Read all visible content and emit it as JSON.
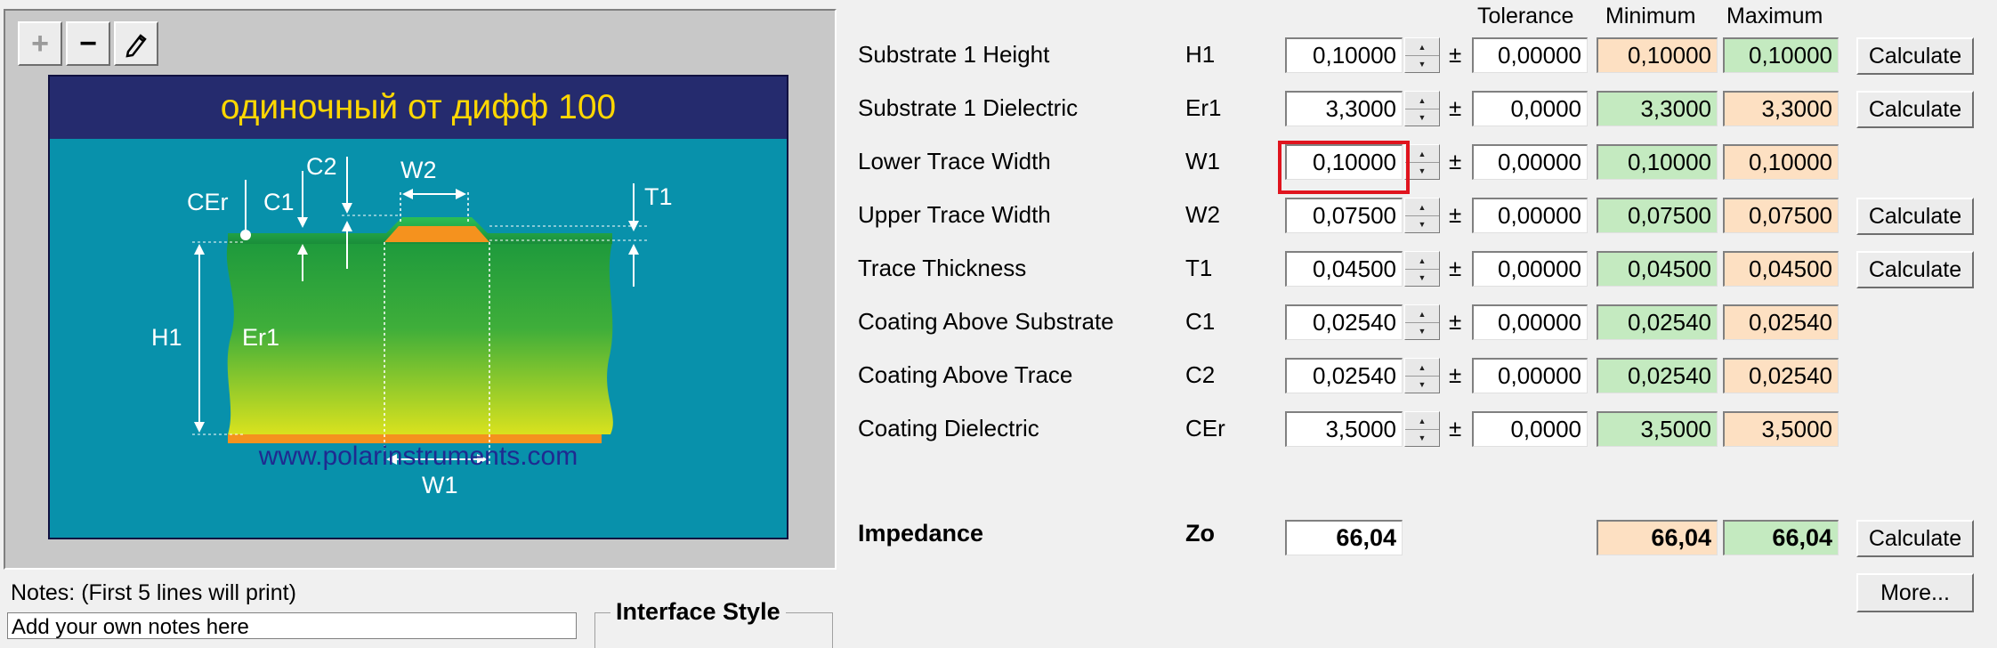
{
  "toolbar": {
    "zoom_in_icon": "plus-icon",
    "zoom_out_icon": "minus-icon",
    "edit_icon": "pencil-icon"
  },
  "diagram": {
    "title": "одиночный от дифф 100",
    "labels": {
      "cer": "CEr",
      "c1": "C1",
      "c2": "C2",
      "w2": "W2",
      "t1": "T1",
      "h1": "H1",
      "er1": "Er1",
      "w1": "W1"
    },
    "website": "www.polarinstruments.com",
    "colors": {
      "title_band": "#252b6e",
      "title_text": "#ffd700",
      "background": "#0891ab",
      "trace": "#f5921e"
    }
  },
  "notes": {
    "label": "Notes: (First 5 lines will print)",
    "value": "Add your own notes here"
  },
  "interface_style": {
    "label": "Interface Style"
  },
  "table": {
    "headers": {
      "tolerance": "Tolerance",
      "minimum": "Minimum",
      "maximum": "Maximum"
    },
    "rows": [
      {
        "label": "Substrate 1 Height",
        "symbol": "H1",
        "value": "0,10000",
        "tolerance": "0,00000",
        "minimum": "0,10000",
        "maximum": "0,10000",
        "min_color": "orange",
        "max_color": "green",
        "calculate": "Calculate"
      },
      {
        "label": "Substrate 1 Dielectric",
        "symbol": "Er1",
        "value": "3,3000",
        "tolerance": "0,0000",
        "minimum": "3,3000",
        "maximum": "3,3000",
        "min_color": "green",
        "max_color": "orange",
        "calculate": "Calculate"
      },
      {
        "label": "Lower Trace Width",
        "symbol": "W1",
        "value": "0,10000",
        "tolerance": "0,00000",
        "minimum": "0,10000",
        "maximum": "0,10000",
        "min_color": "green",
        "max_color": "orange",
        "calculate": ""
      },
      {
        "label": "Upper Trace Width",
        "symbol": "W2",
        "value": "0,07500",
        "tolerance": "0,00000",
        "minimum": "0,07500",
        "maximum": "0,07500",
        "min_color": "green",
        "max_color": "orange",
        "calculate": "Calculate"
      },
      {
        "label": "Trace Thickness",
        "symbol": "T1",
        "value": "0,04500",
        "tolerance": "0,00000",
        "minimum": "0,04500",
        "maximum": "0,04500",
        "min_color": "green",
        "max_color": "orange",
        "calculate": "Calculate"
      },
      {
        "label": "Coating Above Substrate",
        "symbol": "C1",
        "value": "0,02540",
        "tolerance": "0,00000",
        "minimum": "0,02540",
        "maximum": "0,02540",
        "min_color": "green",
        "max_color": "orange",
        "calculate": ""
      },
      {
        "label": "Coating Above Trace",
        "symbol": "C2",
        "value": "0,02540",
        "tolerance": "0,00000",
        "minimum": "0,02540",
        "maximum": "0,02540",
        "min_color": "green",
        "max_color": "orange",
        "calculate": ""
      },
      {
        "label": "Coating Dielectric",
        "symbol": "CEr",
        "value": "3,5000",
        "tolerance": "0,0000",
        "minimum": "3,5000",
        "maximum": "3,5000",
        "min_color": "green",
        "max_color": "orange",
        "calculate": ""
      }
    ],
    "highlighted_row": "Lower Trace Width"
  },
  "impedance": {
    "label": "Impedance",
    "symbol": "Zo",
    "value": "66,04",
    "minimum": "66,04",
    "maximum": "66,04",
    "min_color": "orange",
    "max_color": "green",
    "calculate": "Calculate"
  },
  "more_button": "More...",
  "colors": {
    "orange_field": "#fde0c2",
    "green_field": "#c4eac0",
    "highlight": "#e0141e"
  }
}
